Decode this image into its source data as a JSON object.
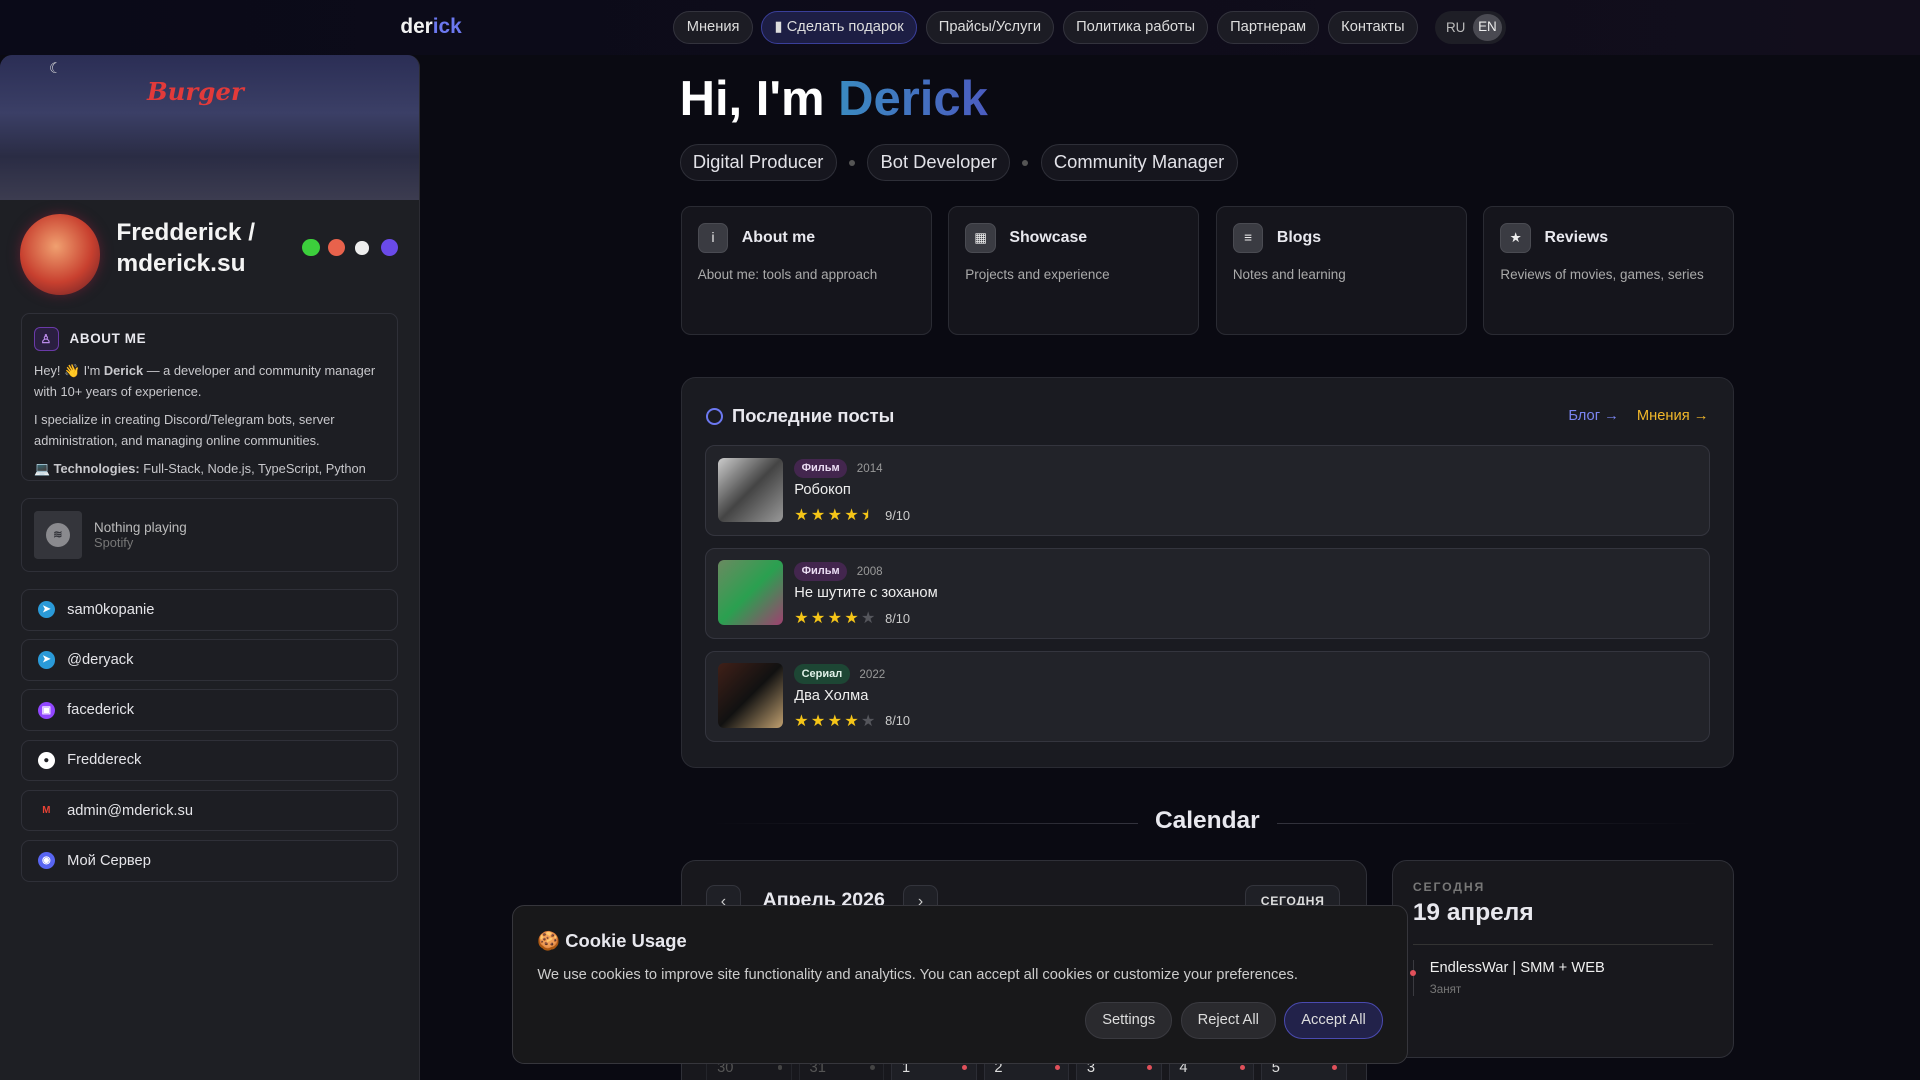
{
  "header": {
    "logo_a": "der",
    "logo_b": "ick",
    "nav": [
      "Мнения",
      "Сделать подарок",
      "Прайсы/Услуги",
      "Политика работы",
      "Партнерам",
      "Контакты"
    ],
    "lang": [
      "RU",
      "EN"
    ],
    "active_lang": "EN"
  },
  "profile": {
    "banner_sign": "Burger",
    "name": "Fredderick / mderick.su",
    "about_title": "ABOUT ME",
    "about_p1_a": "Hey! 👋 I'm ",
    "about_p1_b": "Derick",
    "about_p1_c": " — a developer and community manager with 10+ years of experience.",
    "about_p2": "I specialize in creating Discord/Telegram bots, server administration, and managing online communities.",
    "tech_label": "💻 Technologies:",
    "tech_value": " Full-Stack, Node.js, TypeScript, Python",
    "spotify_status": "Nothing playing",
    "spotify_source": "Spotify",
    "links": [
      {
        "label": "sam0kopanie",
        "icon": "telegram-icon",
        "color": "#2a9ad8"
      },
      {
        "label": "@deryack",
        "icon": "telegram-icon",
        "color": "#2a9ad8"
      },
      {
        "label": "facederick",
        "icon": "twitch-icon",
        "color": "#9146ff"
      },
      {
        "label": "Freddereck",
        "icon": "github-icon",
        "color": "#ffffff"
      },
      {
        "label": "admin@mderick.su",
        "icon": "gmail-icon",
        "color": "#ea4335"
      },
      {
        "label": "Мой Сервер",
        "icon": "discord-icon",
        "color": "#5865f2"
      }
    ]
  },
  "hero": {
    "hi": "Hi, I'm ",
    "name": "Derick",
    "roles": [
      "Digital Producer",
      "Bot Developer",
      "Community Manager"
    ]
  },
  "cards": [
    {
      "title": "About me",
      "desc": "About me: tools and approach",
      "icon": "info-icon"
    },
    {
      "title": "Showcase",
      "desc": "Projects and experience",
      "icon": "showcase-icon"
    },
    {
      "title": "Blogs",
      "desc": "Notes and learning",
      "icon": "blog-icon"
    },
    {
      "title": "Reviews",
      "desc": "Reviews of movies, games, series",
      "icon": "star-icon"
    }
  ],
  "posts": {
    "title": "Последние посты",
    "blog_link": "Блог →",
    "opinions_link": "Мнения →",
    "items": [
      {
        "tag": "Фильм",
        "year": "2014",
        "name": "Робокоп",
        "rating": 9,
        "score": "9/10"
      },
      {
        "tag": "Фильм",
        "year": "2008",
        "name": "Не шутите с зоханом",
        "rating": 8,
        "score": "8/10"
      },
      {
        "tag": "Сериал",
        "year": "2022",
        "name": "Два Холма",
        "rating": 8,
        "score": "8/10"
      }
    ]
  },
  "calendar": {
    "title": "Calendar",
    "month": "Апрель 2026",
    "today_btn": "СЕГОДНЯ",
    "prev": "‹",
    "next": "›",
    "days": [
      "30",
      "31",
      "1",
      "2",
      "3",
      "4",
      "5"
    ]
  },
  "today": {
    "label": "СЕГОДНЯ",
    "date": "19 апреля",
    "event": "EndlessWar | SMM + WEB",
    "status": "Занят"
  },
  "cookie": {
    "title": "🍪 Cookie Usage",
    "text": "We use cookies to improve site functionality and analytics. You can accept all cookies or customize your preferences.",
    "settings": "Settings",
    "reject": "Reject All",
    "accept": "Accept All"
  }
}
